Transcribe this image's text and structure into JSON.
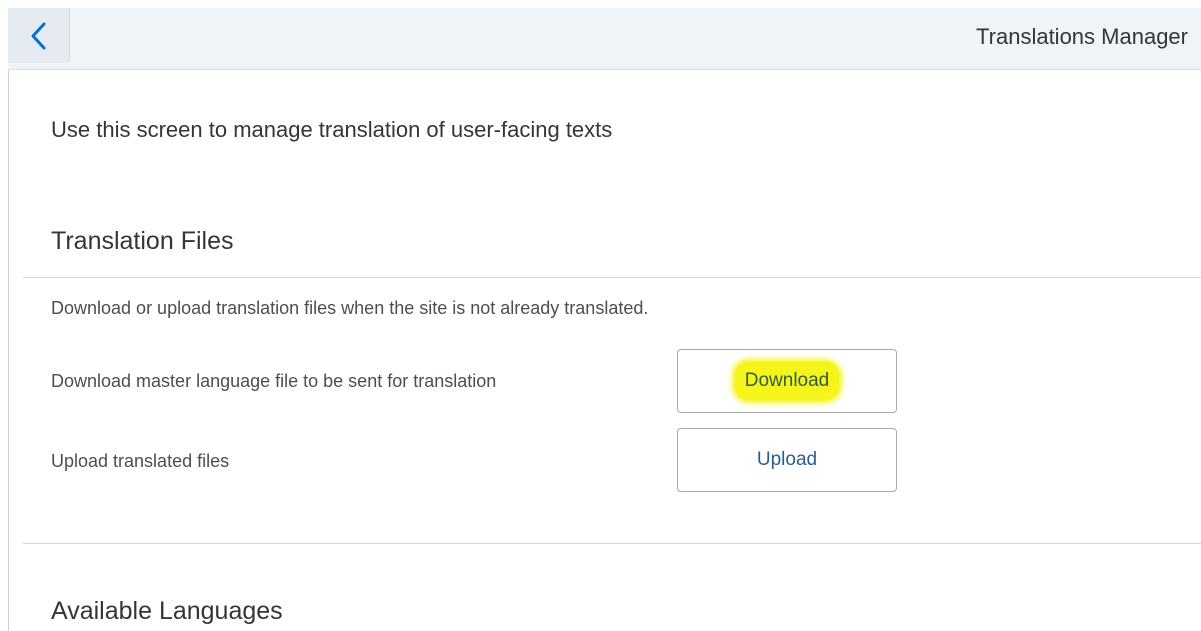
{
  "header": {
    "back_icon": "chevron-left-icon",
    "title": "Translations Manager"
  },
  "intro": "Use this screen to manage translation of user-facing texts",
  "translation_files": {
    "title": "Translation Files",
    "description": "Download or upload translation files when the site is not already translated.",
    "download_label": "Download master language file to be sent for translation",
    "download_button": "Download",
    "upload_label": "Upload translated files",
    "upload_button": "Upload"
  },
  "available_languages": {
    "title": "Available Languages"
  },
  "colors": {
    "accent": "#2a5e8f",
    "header_bg": "#eff4f9",
    "highlight": "#f5f51c"
  }
}
